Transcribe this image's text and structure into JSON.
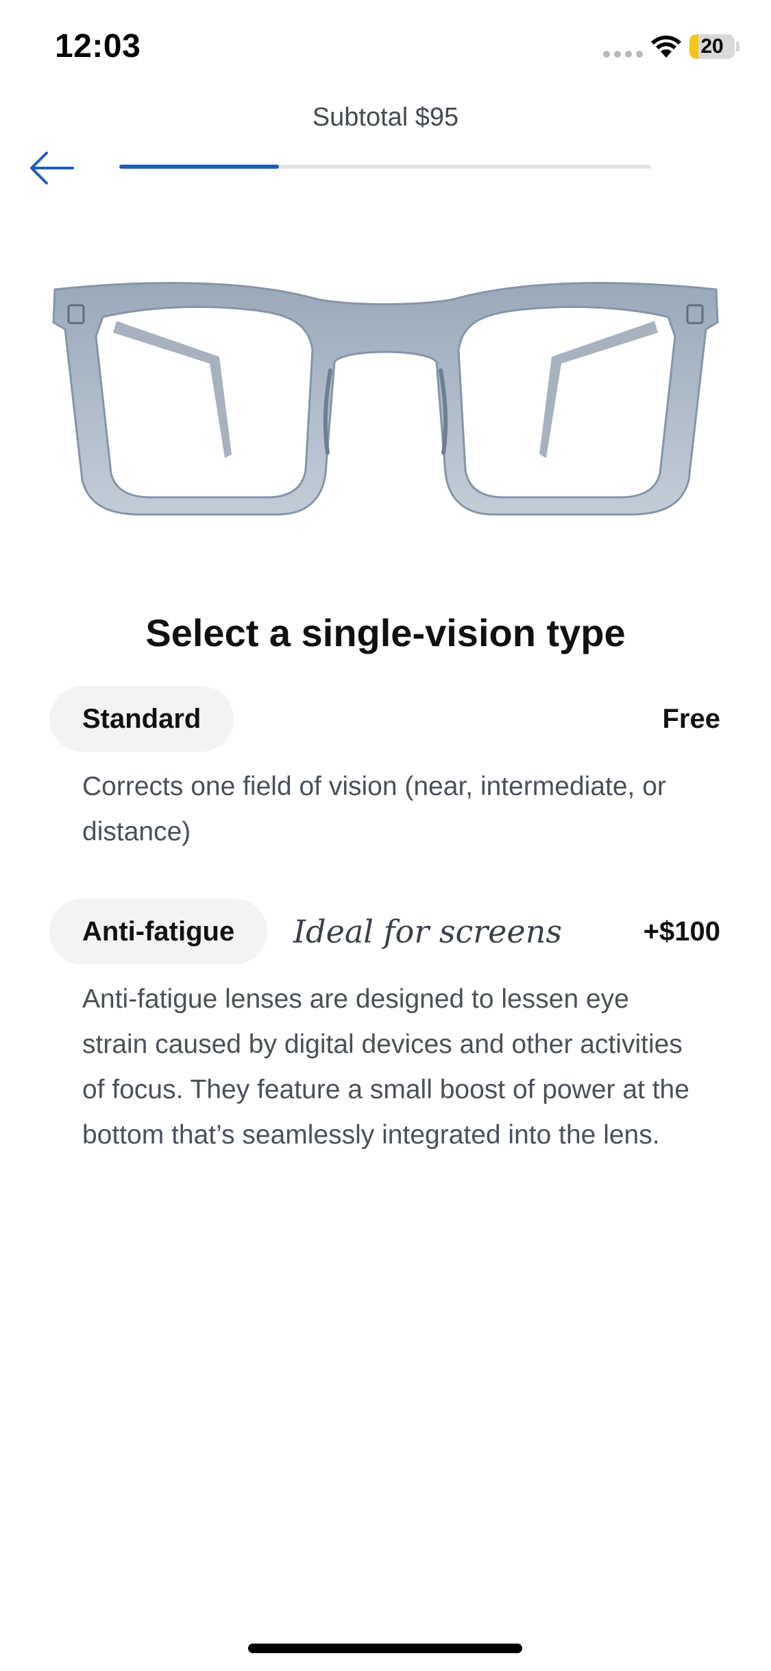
{
  "status_bar": {
    "time": "12:03",
    "battery_level": "20",
    "battery_fraction": 0.2,
    "battery_color": "#f5c518"
  },
  "header": {
    "subtotal": "Subtotal $95",
    "back_icon": "arrow-left-icon",
    "progress_fraction": 0.3,
    "accent_color": "#1f5eb8"
  },
  "product": {
    "image": "eyeglasses-frame"
  },
  "section": {
    "title": "Select a single-vision type"
  },
  "options": [
    {
      "label": "Standard",
      "tagline": "",
      "price": "Free",
      "description": "Corrects one field of vision (near, intermediate, or distance)"
    },
    {
      "label": "Anti-fatigue",
      "tagline": "Ideal for screens",
      "price": "+$100",
      "description": "Anti-fatigue lenses are designed to lessen eye strain caused by digital devices and other activities of focus. They feature a small boost of power at the bottom that’s seamlessly integrated into the lens."
    }
  ]
}
